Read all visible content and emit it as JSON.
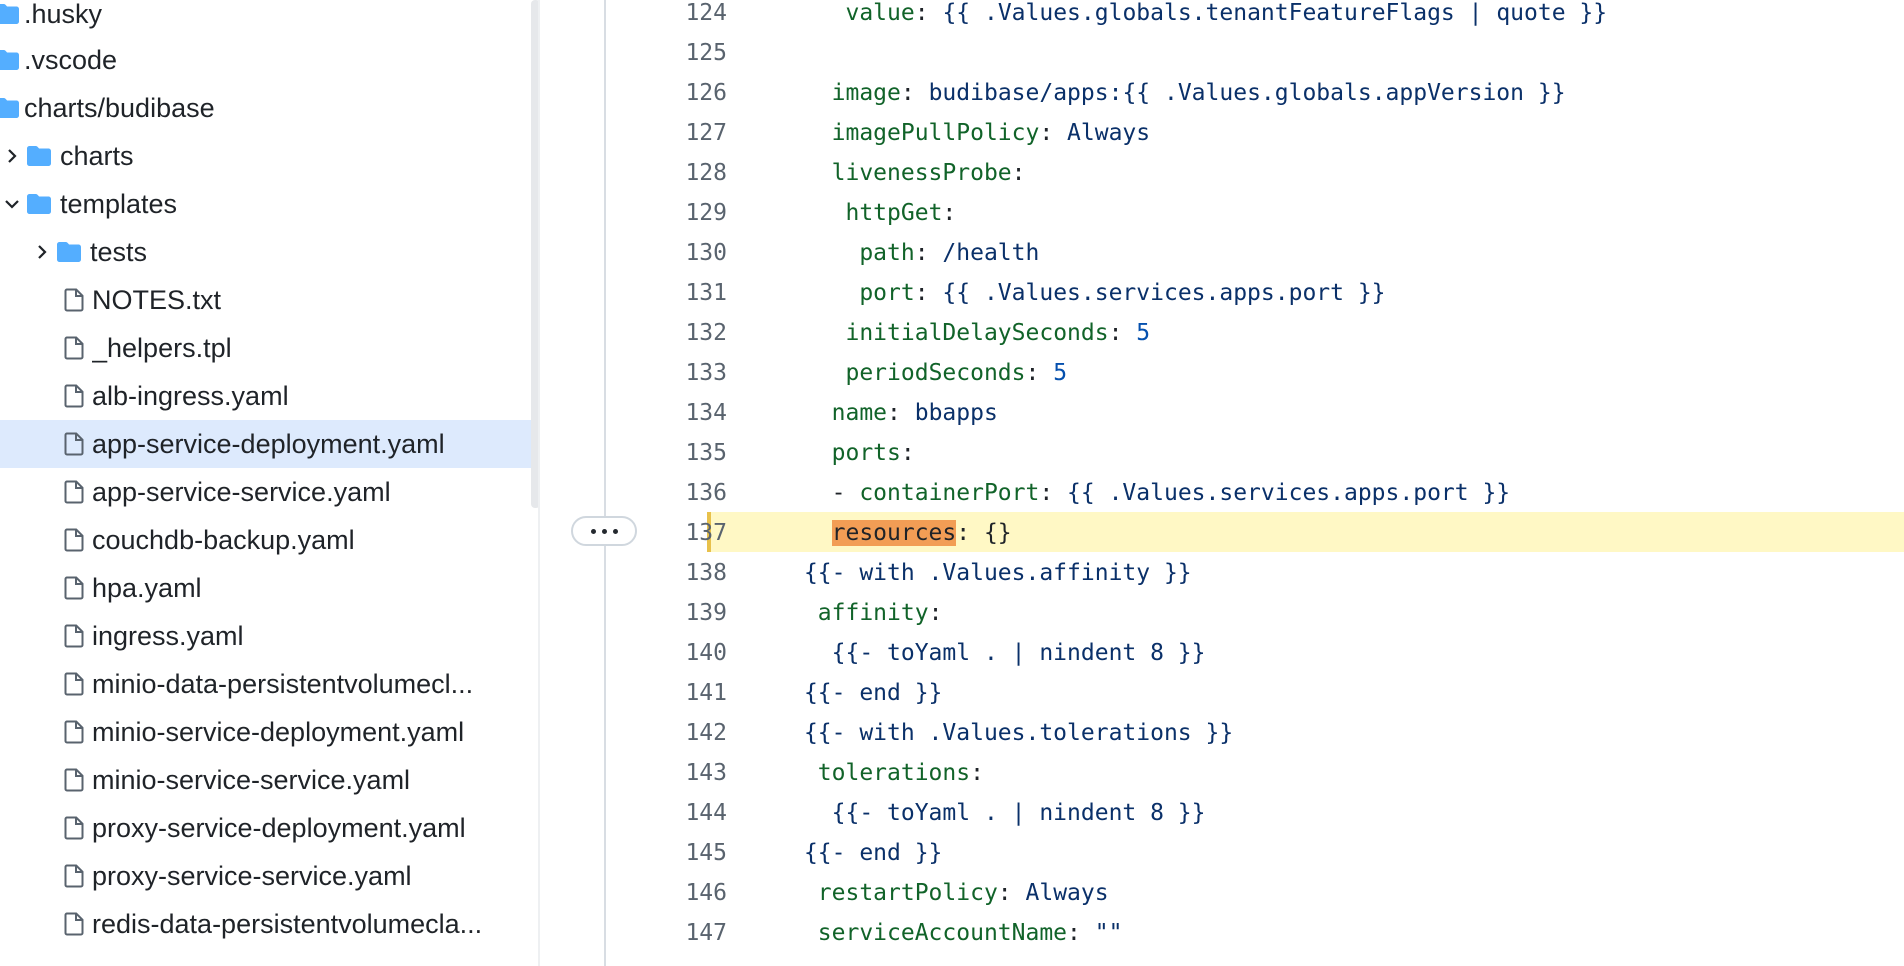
{
  "sidebar": {
    "items": [
      {
        "label": ".husky",
        "type": "folder",
        "chevron": "none",
        "depth": 0
      },
      {
        "label": ".vscode",
        "type": "folder",
        "chevron": "none",
        "depth": 0
      },
      {
        "label": "charts/budibase",
        "type": "folder",
        "chevron": "none",
        "depth": 0
      },
      {
        "label": "charts",
        "type": "folder",
        "chevron": "right",
        "depth": 1
      },
      {
        "label": "templates",
        "type": "folder",
        "chevron": "down",
        "depth": 1
      },
      {
        "label": "tests",
        "type": "folder",
        "chevron": "right",
        "depth": 2
      },
      {
        "label": "NOTES.txt",
        "type": "file",
        "depth": 2
      },
      {
        "label": "_helpers.tpl",
        "type": "file",
        "depth": 2
      },
      {
        "label": "alb-ingress.yaml",
        "type": "file",
        "depth": 2
      },
      {
        "label": "app-service-deployment.yaml",
        "type": "file",
        "depth": 2,
        "selected": true
      },
      {
        "label": "app-service-service.yaml",
        "type": "file",
        "depth": 2
      },
      {
        "label": "couchdb-backup.yaml",
        "type": "file",
        "depth": 2
      },
      {
        "label": "hpa.yaml",
        "type": "file",
        "depth": 2
      },
      {
        "label": "ingress.yaml",
        "type": "file",
        "depth": 2
      },
      {
        "label": "minio-data-persistentvolumecl...",
        "type": "file",
        "depth": 2
      },
      {
        "label": "minio-service-deployment.yaml",
        "type": "file",
        "depth": 2
      },
      {
        "label": "minio-service-service.yaml",
        "type": "file",
        "depth": 2
      },
      {
        "label": "proxy-service-deployment.yaml",
        "type": "file",
        "depth": 2
      },
      {
        "label": "proxy-service-service.yaml",
        "type": "file",
        "depth": 2
      },
      {
        "label": "redis-data-persistentvolumecla...",
        "type": "file",
        "depth": 2
      }
    ]
  },
  "code": {
    "lines": [
      {
        "n": "124",
        "tokens": [
          [
            "p",
            "          "
          ],
          [
            "k",
            "value"
          ],
          [
            "p",
            ": "
          ],
          [
            "v",
            "{{ .Values.globals.tenantFeatureFlags | quote }}"
          ]
        ]
      },
      {
        "n": "125",
        "tokens": []
      },
      {
        "n": "126",
        "tokens": [
          [
            "p",
            "         "
          ],
          [
            "k",
            "image"
          ],
          [
            "p",
            ": "
          ],
          [
            "v",
            "budibase/apps:{{ .Values.globals.appVersion }}"
          ]
        ]
      },
      {
        "n": "127",
        "tokens": [
          [
            "p",
            "         "
          ],
          [
            "k",
            "imagePullPolicy"
          ],
          [
            "p",
            ": "
          ],
          [
            "v",
            "Always"
          ]
        ]
      },
      {
        "n": "128",
        "tokens": [
          [
            "p",
            "         "
          ],
          [
            "k",
            "livenessProbe"
          ],
          [
            "p",
            ":"
          ]
        ]
      },
      {
        "n": "129",
        "tokens": [
          [
            "p",
            "          "
          ],
          [
            "k",
            "httpGet"
          ],
          [
            "p",
            ":"
          ]
        ]
      },
      {
        "n": "130",
        "tokens": [
          [
            "p",
            "           "
          ],
          [
            "k",
            "path"
          ],
          [
            "p",
            ": "
          ],
          [
            "v",
            "/health"
          ]
        ]
      },
      {
        "n": "131",
        "tokens": [
          [
            "p",
            "           "
          ],
          [
            "k",
            "port"
          ],
          [
            "p",
            ": "
          ],
          [
            "v",
            "{{ .Values.services.apps.port }}"
          ]
        ]
      },
      {
        "n": "132",
        "tokens": [
          [
            "p",
            "          "
          ],
          [
            "k",
            "initialDelaySeconds"
          ],
          [
            "p",
            ": "
          ],
          [
            "n",
            "5"
          ]
        ]
      },
      {
        "n": "133",
        "tokens": [
          [
            "p",
            "          "
          ],
          [
            "k",
            "periodSeconds"
          ],
          [
            "p",
            ": "
          ],
          [
            "n",
            "5"
          ]
        ]
      },
      {
        "n": "134",
        "tokens": [
          [
            "p",
            "         "
          ],
          [
            "k",
            "name"
          ],
          [
            "p",
            ": "
          ],
          [
            "v",
            "bbapps"
          ]
        ]
      },
      {
        "n": "135",
        "tokens": [
          [
            "p",
            "         "
          ],
          [
            "k",
            "ports"
          ],
          [
            "p",
            ":"
          ]
        ]
      },
      {
        "n": "136",
        "tokens": [
          [
            "p",
            "         "
          ],
          [
            "p",
            "- "
          ],
          [
            "k",
            "containerPort"
          ],
          [
            "p",
            ": "
          ],
          [
            "v",
            "{{ .Values.services.apps.port }}"
          ]
        ]
      },
      {
        "n": "137",
        "highlight": true,
        "tokens": [
          [
            "p",
            "         "
          ],
          [
            "mark",
            "resources"
          ],
          [
            "p",
            ": {}"
          ]
        ]
      },
      {
        "n": "138",
        "tokens": [
          [
            "p",
            "       "
          ],
          [
            "v",
            "{{- with .Values.affinity }}"
          ]
        ]
      },
      {
        "n": "139",
        "tokens": [
          [
            "p",
            "        "
          ],
          [
            "k",
            "affinity"
          ],
          [
            "p",
            ":"
          ]
        ]
      },
      {
        "n": "140",
        "tokens": [
          [
            "p",
            "         "
          ],
          [
            "v",
            "{{- toYaml . | nindent 8 }}"
          ]
        ]
      },
      {
        "n": "141",
        "tokens": [
          [
            "p",
            "       "
          ],
          [
            "v",
            "{{- end }}"
          ]
        ]
      },
      {
        "n": "142",
        "tokens": [
          [
            "p",
            "       "
          ],
          [
            "v",
            "{{- with .Values.tolerations }}"
          ]
        ]
      },
      {
        "n": "143",
        "tokens": [
          [
            "p",
            "        "
          ],
          [
            "k",
            "tolerations"
          ],
          [
            "p",
            ":"
          ]
        ]
      },
      {
        "n": "144",
        "tokens": [
          [
            "p",
            "         "
          ],
          [
            "v",
            "{{- toYaml . | nindent 8 }}"
          ]
        ]
      },
      {
        "n": "145",
        "tokens": [
          [
            "p",
            "       "
          ],
          [
            "v",
            "{{- end }}"
          ]
        ]
      },
      {
        "n": "146",
        "tokens": [
          [
            "p",
            "        "
          ],
          [
            "k",
            "restartPolicy"
          ],
          [
            "p",
            ": "
          ],
          [
            "v",
            "Always"
          ]
        ]
      },
      {
        "n": "147",
        "tokens": [
          [
            "p",
            "        "
          ],
          [
            "k",
            "serviceAccountName"
          ],
          [
            "p",
            ": "
          ],
          [
            "v",
            "\"\""
          ]
        ]
      }
    ]
  },
  "icons": {
    "folder": "folder-icon",
    "file": "file-icon",
    "more": "more-options-icon"
  },
  "colors": {
    "selected_bg": "#ddeafd",
    "highlight_bg": "#fff8c5",
    "match_bg": "#f29d55",
    "folder": "#54aeff"
  }
}
